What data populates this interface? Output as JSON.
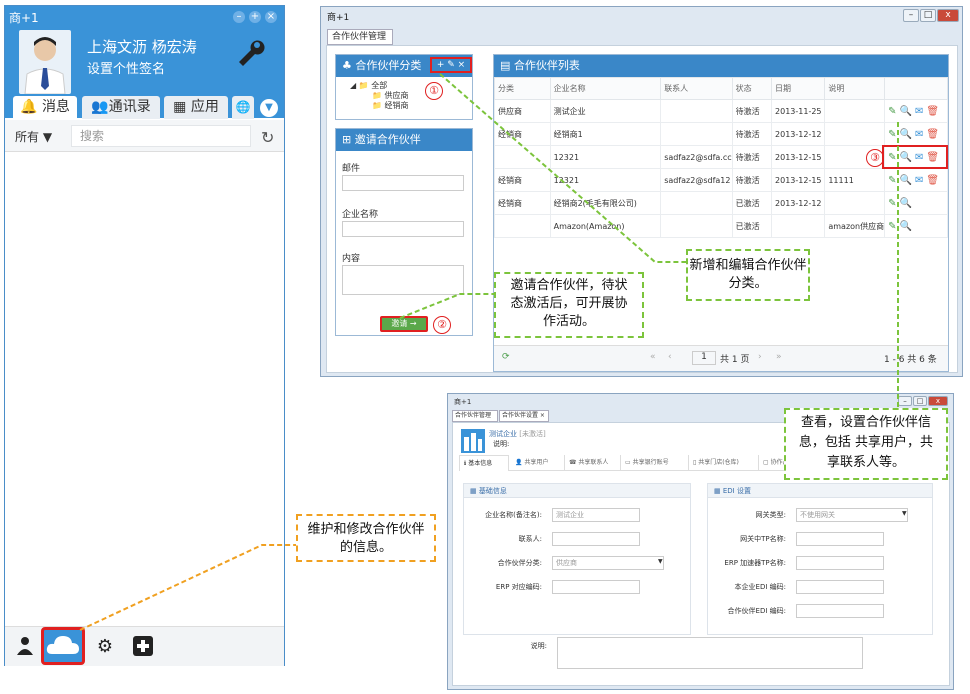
{
  "messenger": {
    "title": "商+1",
    "user_name": "上海文沥 杨宏涛",
    "signature": "设置个性签名",
    "tabs": [
      "消息",
      "通讯录",
      "应用"
    ],
    "filter_all": "所有",
    "search_placeholder": "搜索"
  },
  "win1": {
    "title": "商+1",
    "tab": "合作伙伴管理",
    "category_panel_title": "合作伙伴分类",
    "tree": [
      "全部",
      "供应商",
      "经销商"
    ],
    "invite_panel_title": "邀请合作伙伴",
    "invite_fields": [
      "邮件",
      "企业名称",
      "内容"
    ],
    "invite_button": "邀请",
    "list_title": "合作伙伴列表",
    "columns": [
      "分类",
      "企业名称",
      "联系人",
      "状态",
      "日期",
      "说明"
    ],
    "rows": [
      [
        "供应商",
        "测试企业",
        "",
        "待激活",
        "2013-11-25",
        ""
      ],
      [
        "经销商",
        "经销商1",
        "",
        "待激活",
        "2013-12-12",
        ""
      ],
      [
        "",
        "12321",
        "sadfaz2@sdfa.cc",
        "待激活",
        "2013-12-15",
        ""
      ],
      [
        "经销商",
        "12321",
        "sadfaz2@sdfa12",
        "待激活",
        "2013-12-15",
        "11111"
      ],
      [
        "经销商",
        "经销商2(毛毛有限公司)",
        "",
        "已激活",
        "2013-12-12",
        ""
      ],
      [
        "",
        "Amazon(Amazon)",
        "",
        "已激活",
        "",
        "amazon供应商"
      ]
    ],
    "pager_page": "1",
    "pager_total_pages": "共 1 页",
    "pager_summary": "1 - 6  共 6 条"
  },
  "win2": {
    "title": "商+1",
    "tabs": [
      "合作伙伴管理",
      "合作伙伴设置"
    ],
    "company": "测试企业",
    "company_status": "[未激活]",
    "desc_label": "说明:",
    "subtabs": [
      "基本信息",
      "共享用户",
      "共享联系人",
      "共享银行账号",
      "共享门店(仓库)",
      "协作品牌"
    ],
    "basic_section": "基础信息",
    "edi_section": "EDI 设置",
    "basic_fields": [
      {
        "label": "企业名称(备注名):",
        "value": "测试企业"
      },
      {
        "label": "联系人:",
        "value": ""
      },
      {
        "label": "合作伙伴分类:",
        "value": "供应商"
      },
      {
        "label": "ERP 对应编码:",
        "value": ""
      }
    ],
    "edi_fields": [
      {
        "label": "网关类型:",
        "value": "不使用网关"
      },
      {
        "label": "网关中TP名称:",
        "value": ""
      },
      {
        "label": "ERP 加速器TP名称:",
        "value": ""
      },
      {
        "label": "本企业EDI 编码:",
        "value": ""
      },
      {
        "label": "合作伙伴EDI 编码:",
        "value": ""
      }
    ],
    "notes_label": "说明:"
  },
  "callouts": {
    "c1": "新增和编辑合作伙伴分类。",
    "c2": "邀请合作伙伴，待状态激活后，可开展协作活动。",
    "c3": "查看，设置合作伙伴信息，包括 共享用户，共享联系人等。",
    "c4": "维护和修改合作伙伴的信息。"
  },
  "markers": [
    "①",
    "②",
    "③"
  ],
  "colors": {
    "accent": "#3a93d8",
    "highlight": "#e02020",
    "green_dash": "#7cc43c",
    "orange_dash": "#f0a020"
  }
}
